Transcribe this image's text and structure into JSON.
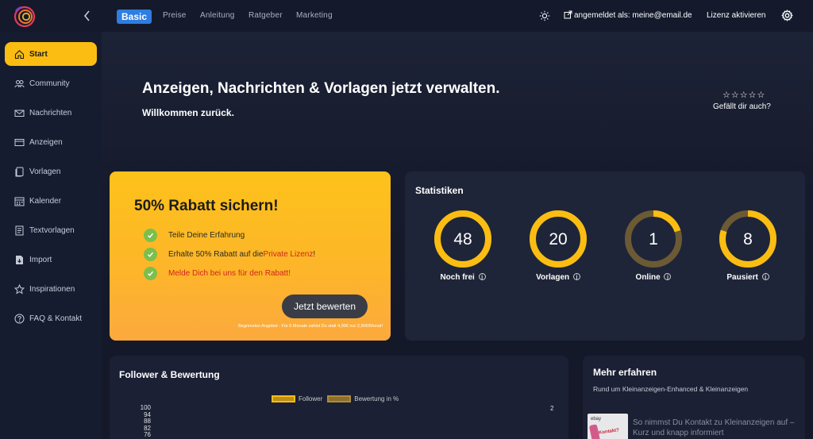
{
  "topbar": {
    "plan_badge": "Basic",
    "nav": [
      "Preise",
      "Anleitung",
      "Ratgeber",
      "Marketing"
    ],
    "login": "angemeldet als: meine@email.de",
    "license": "Lizenz aktivieren"
  },
  "sidebar": {
    "items": [
      {
        "label": "Start",
        "icon": "home-icon"
      },
      {
        "label": "Community",
        "icon": "users-icon"
      },
      {
        "label": "Nachrichten",
        "icon": "mail-icon"
      },
      {
        "label": "Anzeigen",
        "icon": "ads-icon"
      },
      {
        "label": "Vorlagen",
        "icon": "template-icon"
      },
      {
        "label": "Kalender",
        "icon": "calendar-icon"
      },
      {
        "label": "Textvorlagen",
        "icon": "text-template-icon"
      },
      {
        "label": "Import",
        "icon": "import-icon"
      },
      {
        "label": "Inspirationen",
        "icon": "star-icon"
      },
      {
        "label": "FAQ & Kontakt",
        "icon": "help-icon"
      }
    ]
  },
  "hero": {
    "title": "Anzeigen, Nachrichten & Vorlagen jetzt verwalten.",
    "subtitle": "Willkommen zurück.",
    "rating_label": "Gefällt dir auch?"
  },
  "promo": {
    "title": "50% Rabatt sichern!",
    "items": [
      {
        "text": "Teile Deine Erfahrung"
      },
      {
        "text": "Erhalte 50% Rabatt auf die ",
        "highlight": "Private Lizenz",
        "suffix": "!"
      },
      {
        "text": "Melde Dich bei uns für den Rabatt!"
      }
    ],
    "button": "Jetzt bewerten",
    "note": "Begrenztes Angebot - Für 6 Monate zahlst Du statt 4,99€ nur 2,50€/Monat!"
  },
  "stats": {
    "title": "Statistiken",
    "items": [
      {
        "value": "48",
        "label": "Noch frei",
        "fill": 1.0
      },
      {
        "value": "20",
        "label": "Vorlagen",
        "fill": 1.0
      },
      {
        "value": "1",
        "label": "Online",
        "fill": 0.2
      },
      {
        "value": "8",
        "label": "Pausiert",
        "fill": 0.8
      }
    ]
  },
  "follower": {
    "title": "Follower & Bewertung",
    "legend": [
      "Follower",
      "Bewertung in %"
    ],
    "y_ticks_left": [
      "100",
      "94",
      "88",
      "82",
      "76"
    ],
    "y_tick_right": "2"
  },
  "more": {
    "title": "Mehr erfahren",
    "subtitle": "Rund um Kleinanzeigen-Enhanced & Kleinanzeigen",
    "article": "So nimmst Du Kontakt zu Kleinanzeigen auf – Kurz und knapp informiert",
    "thumb_brand": "ebay",
    "thumb_text": "Kontakt?"
  },
  "colors": {
    "accent": "#fbbd12",
    "ring_dim": "#6b5a34",
    "badge": "#2f7de1"
  }
}
